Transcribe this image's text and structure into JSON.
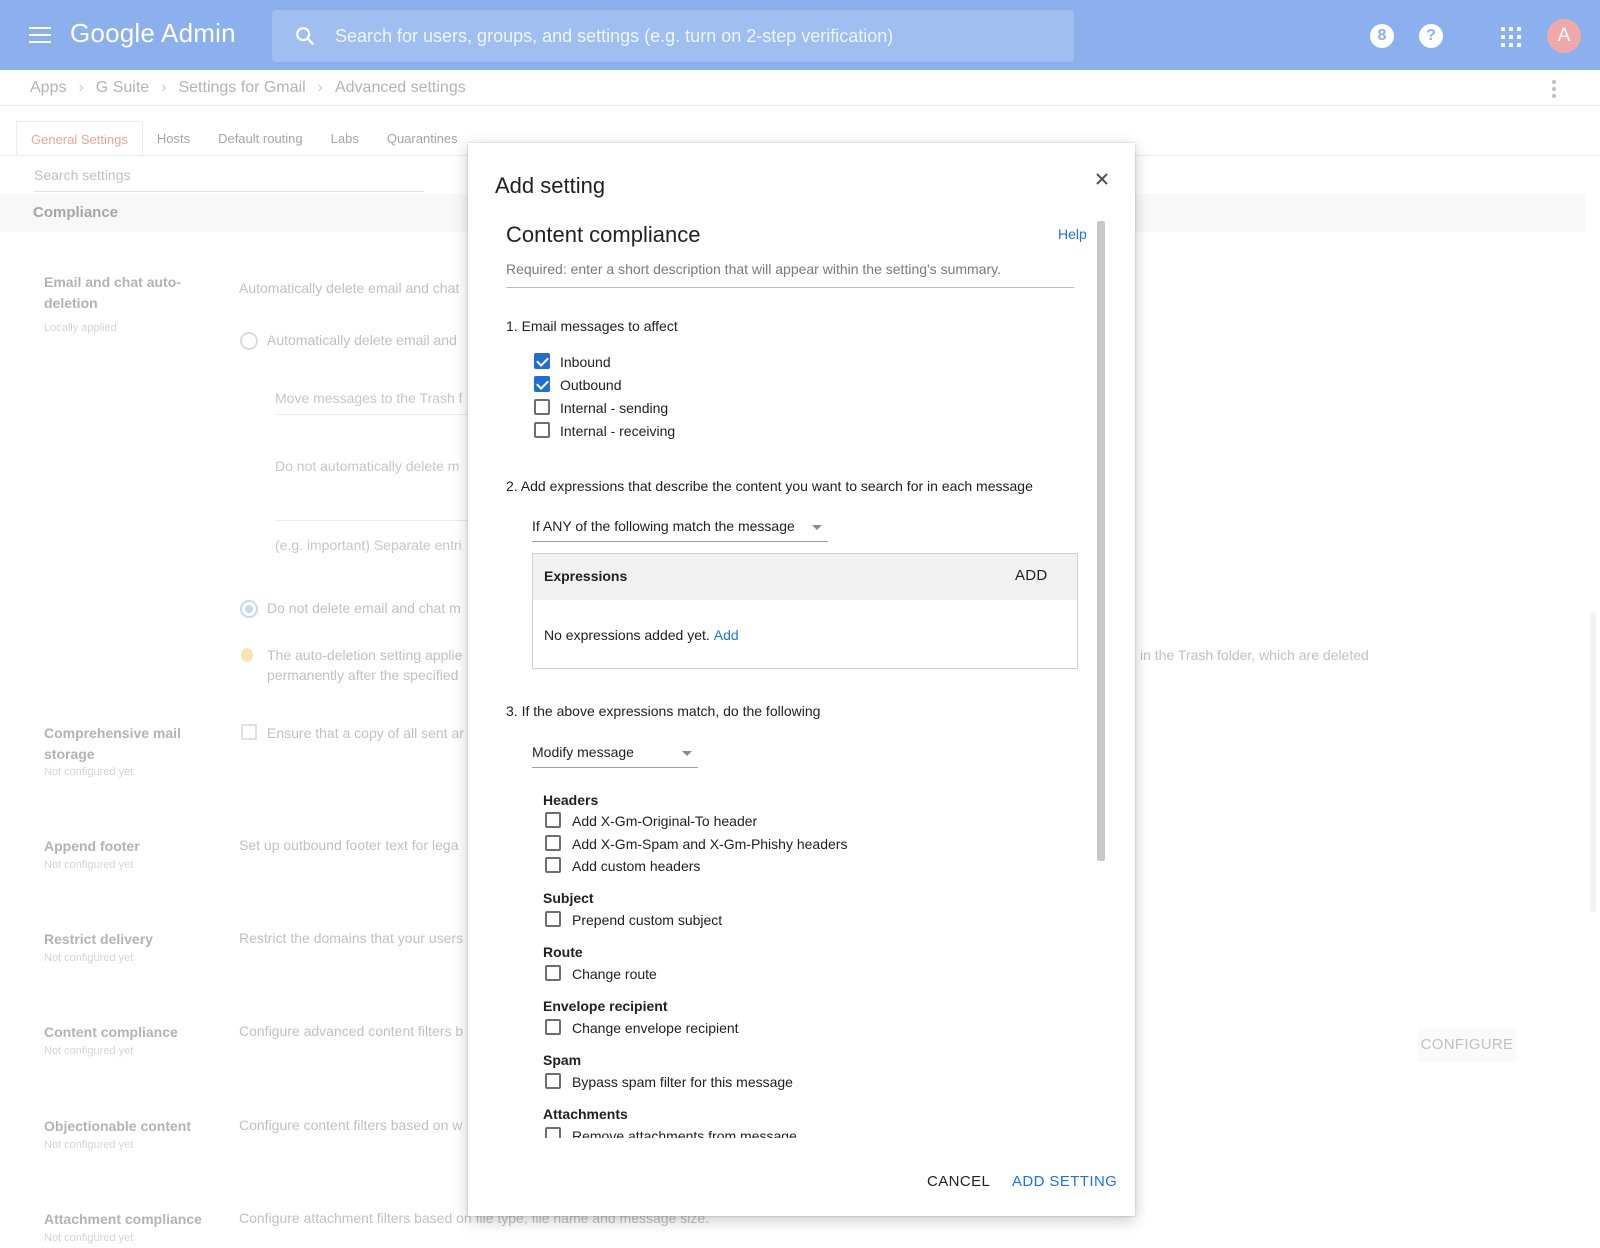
{
  "app": {
    "logo": "Google Admin",
    "search_placeholder": "Search for users, groups, and settings (e.g. turn on 2-step verification)",
    "notification_glyph": "8",
    "help_glyph": "?",
    "avatar_letter": "A"
  },
  "breadcrumb": [
    "Apps",
    "G Suite",
    "Settings for Gmail",
    "Advanced settings"
  ],
  "tabs": [
    "General Settings",
    "Hosts",
    "Default routing",
    "Labs",
    "Quarantines"
  ],
  "settings_search_placeholder": "Search settings",
  "section": "Compliance",
  "background": {
    "auto_deletion": {
      "title": "Email and chat auto-deletion",
      "sub": "Locally applied",
      "desc": "Automatically delete email and chat",
      "option_auto": "Automatically delete email and",
      "field_move": "Move messages to the Trash f",
      "field_donot": "Do not automatically delete m",
      "field_eg": "(e.g. important) Separate entri",
      "option_donot": "Do not delete email and chat m",
      "note_line1": "The auto-deletion setting applie",
      "note_line2": "permanently after the specified",
      "note_tail": "in the Trash folder, which are deleted"
    },
    "rows": [
      {
        "title": "Comprehensive mail storage",
        "sub": "Not configured yet",
        "desc": "Ensure that a copy of all sent ar"
      },
      {
        "title": "Append footer",
        "sub": "Not configured yet",
        "desc": "Set up outbound footer text for lega"
      },
      {
        "title": "Restrict delivery",
        "sub": "Not configured yet",
        "desc": "Restrict the domains that your users"
      },
      {
        "title": "Content compliance",
        "sub": "Not configured yet",
        "desc": "Configure advanced content filters b"
      },
      {
        "title": "Objectionable content",
        "sub": "Not configured yet",
        "desc": "Configure content filters based on w"
      },
      {
        "title": "Attachment compliance",
        "sub": "Not configured yet",
        "desc": "Configure attachment filters based on file type, file name and message size."
      }
    ],
    "configure_button": "CONFIGURE"
  },
  "dialog": {
    "title": "Add setting",
    "section_title": "Content compliance",
    "help_label": "Help",
    "description_placeholder": "Required: enter a short description that will appear within the setting's summary.",
    "step1": {
      "label": "1. Email messages to affect",
      "options": [
        {
          "label": "Inbound",
          "checked": true
        },
        {
          "label": "Outbound",
          "checked": true
        },
        {
          "label": "Internal - sending",
          "checked": false
        },
        {
          "label": "Internal - receiving",
          "checked": false
        }
      ]
    },
    "step2": {
      "label": "2. Add expressions that describe the content you want to search for in each message",
      "match_mode": "If ANY of the following match the message",
      "expressions_header": "Expressions",
      "add_button": "ADD",
      "empty_text": "No expressions added yet.",
      "empty_add_link": "Add"
    },
    "step3": {
      "label": "3. If the above expressions match, do the following",
      "action": "Modify message",
      "groups": [
        {
          "label": "Headers",
          "options": [
            "Add X-Gm-Original-To header",
            "Add X-Gm-Spam and X-Gm-Phishy headers",
            "Add custom headers"
          ]
        },
        {
          "label": "Subject",
          "options": [
            "Prepend custom subject"
          ]
        },
        {
          "label": "Route",
          "options": [
            "Change route"
          ]
        },
        {
          "label": "Envelope recipient",
          "options": [
            "Change envelope recipient"
          ]
        },
        {
          "label": "Spam",
          "options": [
            "Bypass spam filter for this message"
          ]
        },
        {
          "label": "Attachments",
          "options": [
            "Remove attachments from message"
          ]
        }
      ]
    },
    "cancel_button": "CANCEL",
    "submit_button": "ADD SETTING"
  },
  "colors": {
    "appbar": "#4d86e3",
    "accent_blue": "#1a73e8",
    "checkbox_checked": "#1f6ed4",
    "active_tab": "#e0756a"
  }
}
